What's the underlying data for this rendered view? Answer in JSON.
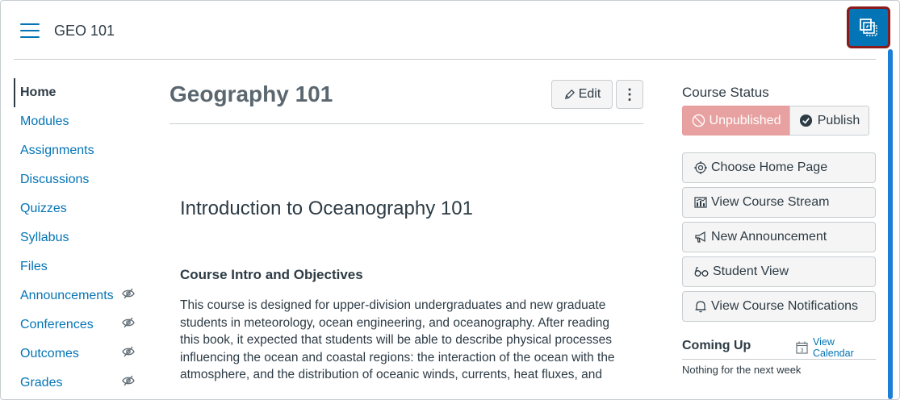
{
  "header": {
    "breadcrumb": "GEO 101"
  },
  "nav": {
    "items": [
      {
        "label": "Home",
        "hidden": false
      },
      {
        "label": "Modules",
        "hidden": false
      },
      {
        "label": "Assignments",
        "hidden": false
      },
      {
        "label": "Discussions",
        "hidden": false
      },
      {
        "label": "Quizzes",
        "hidden": false
      },
      {
        "label": "Syllabus",
        "hidden": false
      },
      {
        "label": "Files",
        "hidden": false
      },
      {
        "label": "Announcements",
        "hidden": true
      },
      {
        "label": "Conferences",
        "hidden": true
      },
      {
        "label": "Outcomes",
        "hidden": true
      },
      {
        "label": "Grades",
        "hidden": true
      }
    ],
    "hidden_icon": "eye-slash-icon"
  },
  "main": {
    "title": "Geography 101",
    "edit_label": "Edit",
    "more_label": "⋮",
    "heading": "Introduction to Oceanography 101",
    "subheading": "Course Intro and Objectives",
    "paragraph": "This course is designed for upper-division undergraduates and new graduate students in meteorology, ocean engineering, and oceanography. After reading this book, it expected that students will be able to describe physical processes influencing the ocean and coastal regions: the interaction of the ocean with the atmosphere, and the distribution of oceanic winds, currents, heat fluxes, and"
  },
  "sidebar": {
    "status_title": "Course Status",
    "unpublished_label": "Unpublished",
    "publish_label": "Publish",
    "buttons": [
      {
        "label": "Choose Home Page",
        "icon": "target-icon"
      },
      {
        "label": "View Course Stream",
        "icon": "stream-icon"
      },
      {
        "label": "New Announcement",
        "icon": "megaphone-icon"
      },
      {
        "label": "Student View",
        "icon": "glasses-icon"
      },
      {
        "label": "View Course Notifications",
        "icon": "bell-icon"
      }
    ],
    "coming_up": "Coming Up",
    "view_calendar": "View Calendar",
    "calendar_day": "3",
    "nothing": "Nothing for the next week"
  },
  "colors": {
    "link": "#0374b5",
    "tray_button": "#0374b5",
    "tray_outline": "#8b1a1a",
    "unpublished_bg": "#e8a1a1"
  }
}
